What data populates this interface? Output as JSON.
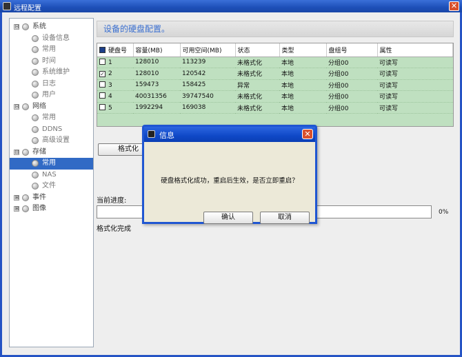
{
  "window": {
    "title": "远程配置",
    "close": "✕"
  },
  "tree": [
    {
      "label": "系统",
      "level": 1,
      "toggle": "⊟",
      "selected": false
    },
    {
      "label": "设备信息",
      "level": 2,
      "selected": false
    },
    {
      "label": "常用",
      "level": 2,
      "selected": false
    },
    {
      "label": "时间",
      "level": 2,
      "selected": false
    },
    {
      "label": "系统维护",
      "level": 2,
      "selected": false
    },
    {
      "label": "日志",
      "level": 2,
      "selected": false
    },
    {
      "label": "用户",
      "level": 2,
      "selected": false
    },
    {
      "label": "网络",
      "level": 1,
      "toggle": "⊟",
      "selected": false
    },
    {
      "label": "常用",
      "level": 2,
      "selected": false
    },
    {
      "label": "DDNS",
      "level": 2,
      "selected": false
    },
    {
      "label": "高级设置",
      "level": 2,
      "selected": false
    },
    {
      "label": "存储",
      "level": 1,
      "toggle": "⊟",
      "selected": false
    },
    {
      "label": "常用",
      "level": 2,
      "selected": true
    },
    {
      "label": "NAS",
      "level": 2,
      "selected": false
    },
    {
      "label": "文件",
      "level": 2,
      "selected": false
    },
    {
      "label": "事件",
      "level": 1,
      "toggle": "⊞",
      "selected": false
    },
    {
      "label": "图像",
      "level": 1,
      "toggle": "⊞",
      "selected": false
    }
  ],
  "main": {
    "heading": "设备的硬盘配置。",
    "columns": [
      "硬盘号",
      "容量(MB)",
      "可用空间(MB)",
      "状态",
      "类型",
      "盘组号",
      "属性"
    ],
    "rows": [
      {
        "checked": false,
        "cells": [
          "1",
          "128010",
          "113239",
          "未格式化",
          "本地",
          "分组00",
          "可读写"
        ]
      },
      {
        "checked": true,
        "cells": [
          "2",
          "128010",
          "120542",
          "未格式化",
          "本地",
          "分组00",
          "可读写"
        ]
      },
      {
        "checked": false,
        "cells": [
          "3",
          "159473",
          "158425",
          "异常",
          "本地",
          "分组00",
          "可读写"
        ]
      },
      {
        "checked": false,
        "cells": [
          "4",
          "40031356",
          "39747540",
          "未格式化",
          "本地",
          "分组00",
          "可读写"
        ]
      },
      {
        "checked": false,
        "cells": [
          "5",
          "1992294",
          "169038",
          "未格式化",
          "本地",
          "分组00",
          "可读写"
        ]
      }
    ],
    "format_button": "格式化",
    "progress_label": "当前进度:",
    "progress_percent": "0%",
    "progress_value": 0,
    "status": "格式化完成"
  },
  "dialog": {
    "title": "信息",
    "close": "✕",
    "message": "硬盘格式化成功，重启后生效，是否立即重启？",
    "ok": "确认",
    "cancel": "取消"
  },
  "icons": {
    "checkmark": "✓"
  }
}
